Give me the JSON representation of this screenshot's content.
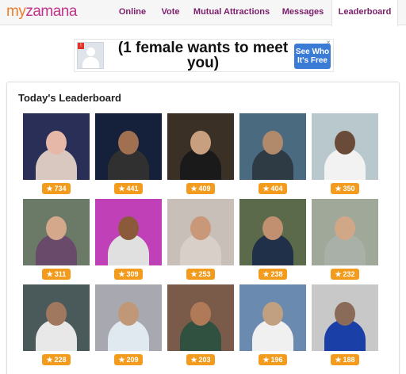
{
  "header": {
    "logo_my": "my",
    "logo_rest": "zamana",
    "nav": [
      {
        "label": "Online"
      },
      {
        "label": "Vote"
      },
      {
        "label": "Mutual Attractions"
      },
      {
        "label": "Messages"
      },
      {
        "label": "Leaderboard"
      }
    ]
  },
  "ad": {
    "headline": "(1 female wants to meet you)",
    "cta": "See Who It's Free"
  },
  "leaderboard": {
    "title": "Today's Leaderboard",
    "star_icon": "★",
    "members": [
      {
        "score": "734"
      },
      {
        "score": "441"
      },
      {
        "score": "409"
      },
      {
        "score": "404"
      },
      {
        "score": "350"
      },
      {
        "score": "311"
      },
      {
        "score": "309"
      },
      {
        "score": "253"
      },
      {
        "score": "238"
      },
      {
        "score": "232"
      },
      {
        "score": "228"
      },
      {
        "score": "209"
      },
      {
        "score": "203"
      },
      {
        "score": "196"
      },
      {
        "score": "188"
      }
    ]
  }
}
